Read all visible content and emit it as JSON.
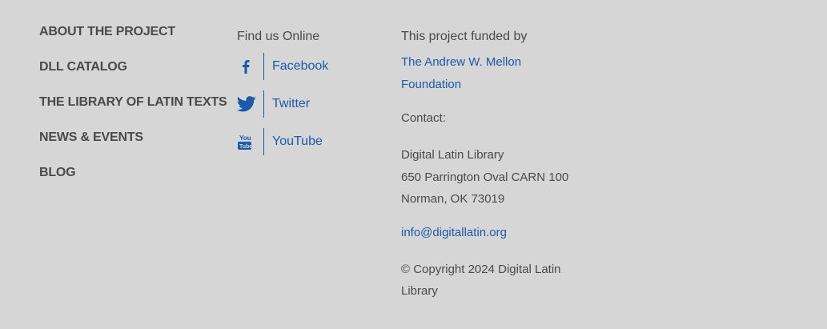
{
  "nav": {
    "items": [
      {
        "label": "ABOUT THE PROJECT"
      },
      {
        "label": "DLL CATALOG"
      },
      {
        "label": "THE LIBRARY OF LATIN TEXTS"
      },
      {
        "label": "NEWS & EVENTS"
      },
      {
        "label": "BLOG"
      }
    ]
  },
  "social": {
    "heading": "Find us Online",
    "items": [
      {
        "label": "Facebook",
        "icon": "facebook-icon"
      },
      {
        "label": "Twitter",
        "icon": "twitter-icon"
      },
      {
        "label": "YouTube",
        "icon": "youtube-icon"
      }
    ]
  },
  "info": {
    "funded_label": "This project funded by",
    "funder": "The Andrew W. Mellon Foundation",
    "contact_label": "Contact:",
    "address": {
      "line1": "Digital Latin Library",
      "line2": "650 Parrington Oval CARN 100",
      "line3": "Norman, OK 73019"
    },
    "email": "info@digitallatin.org",
    "copyright": "© Copyright 2024 Digital Latin Library"
  },
  "colors": {
    "background": "#d6d6d6",
    "text": "#4a4a4a",
    "link": "#1a5aa8"
  }
}
